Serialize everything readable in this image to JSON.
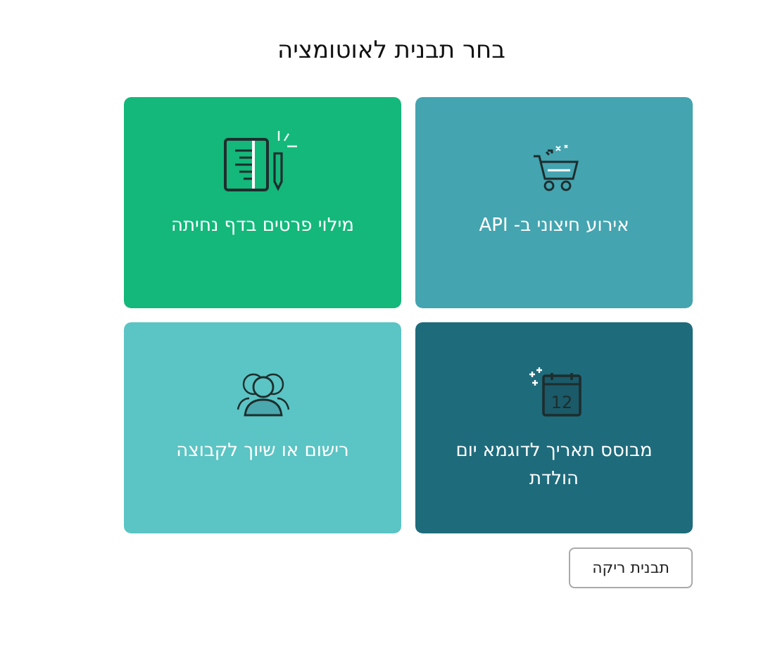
{
  "title": "בחר תבנית לאוטומציה",
  "templates": [
    {
      "kind": "cart",
      "label": "אירוע חיצוני ב- API",
      "color": "#44a4b0"
    },
    {
      "kind": "notebook",
      "label": "מילוי פרטים בדף נחיתה",
      "color": "#13b87a"
    },
    {
      "kind": "calendar",
      "label": "מבוסס תאריך לדוגמא יום הולדת",
      "color": "#1e6b7c",
      "day": "12"
    },
    {
      "kind": "people",
      "label": "רישום או שיוך לקבוצה",
      "color": "#5bc4c4"
    }
  ],
  "empty_button": "תבנית ריקה"
}
